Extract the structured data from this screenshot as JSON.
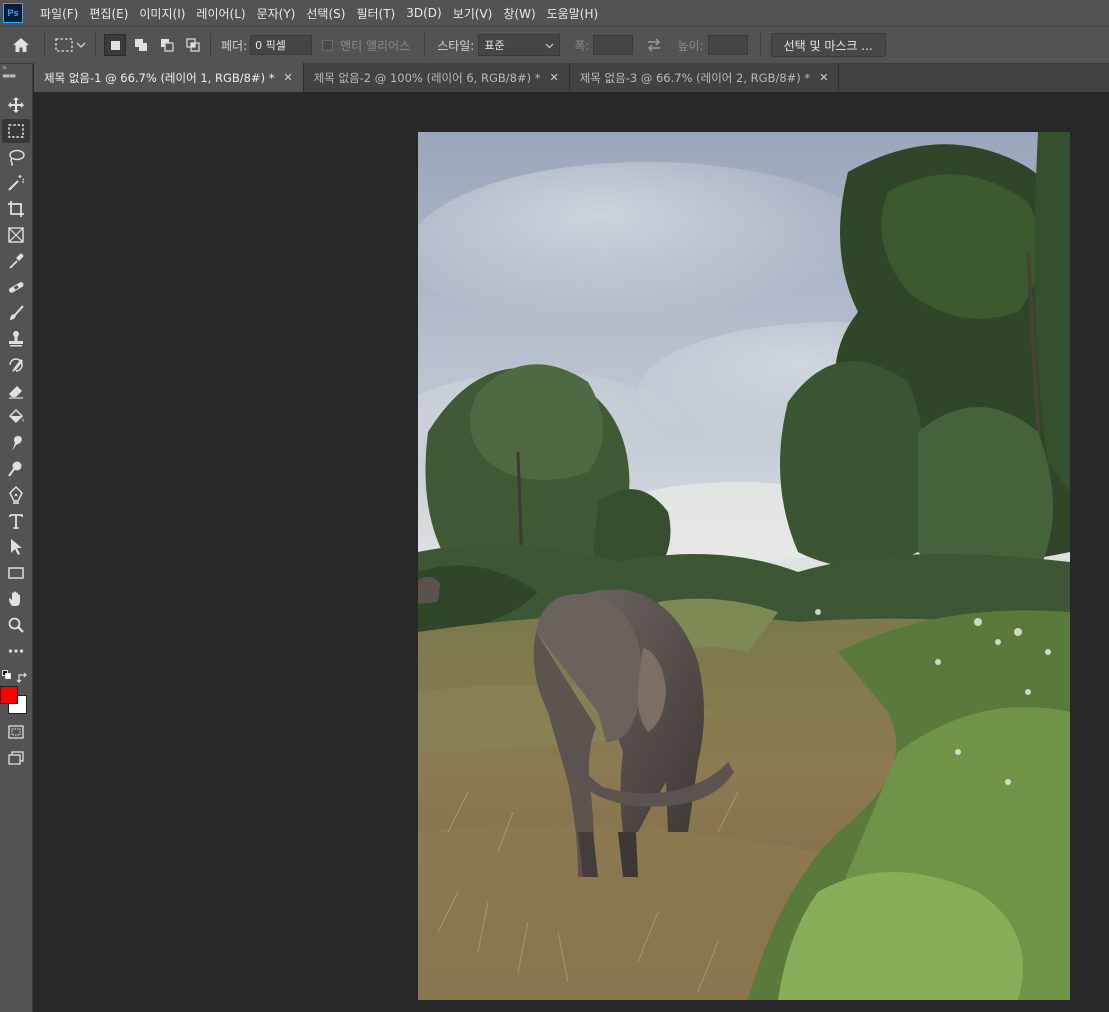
{
  "app": {
    "logo_text": "Ps"
  },
  "menu": [
    "파일(F)",
    "편집(E)",
    "이미지(I)",
    "레이어(L)",
    "문자(Y)",
    "선택(S)",
    "필터(T)",
    "3D(D)",
    "보기(V)",
    "창(W)",
    "도움말(H)"
  ],
  "options": {
    "feather_label": "페더:",
    "feather_value": "0 픽셀",
    "antialias_label": "앤티 앨리어스",
    "style_label": "스타일:",
    "style_value": "표준",
    "width_label": "폭:",
    "height_label": "높이:",
    "select_mask_label": "선택 및 마스크 ..."
  },
  "tabs": [
    {
      "label": "제목 없음-1 @ 66.7% (레이어 1, RGB/8#) *",
      "active": true
    },
    {
      "label": "제목 없음-2 @ 100% (레이어 6, RGB/8#) *",
      "active": false
    },
    {
      "label": "제목 없음-3 @ 66.7% (레이어 2, RGB/8#) *",
      "active": false
    }
  ],
  "tools": [
    "move-tool",
    "rectangular-marquee-tool",
    "lasso-tool",
    "magic-wand-tool",
    "crop-tool",
    "frame-tool",
    "eyedropper-tool",
    "healing-brush-tool",
    "brush-tool",
    "clone-stamp-tool",
    "history-brush-tool",
    "eraser-tool",
    "paint-bucket-tool",
    "smudge-tool",
    "dodge-tool",
    "pen-tool",
    "type-tool",
    "path-selection-tool",
    "rectangle-tool",
    "hand-tool",
    "zoom-tool",
    "edit-toolbar"
  ],
  "colors": {
    "foreground": "#ff0000",
    "background": "#ffffff",
    "ui_panel": "#535353",
    "canvas_bg": "#282828"
  },
  "image": {
    "subject": "elephant-photo"
  }
}
